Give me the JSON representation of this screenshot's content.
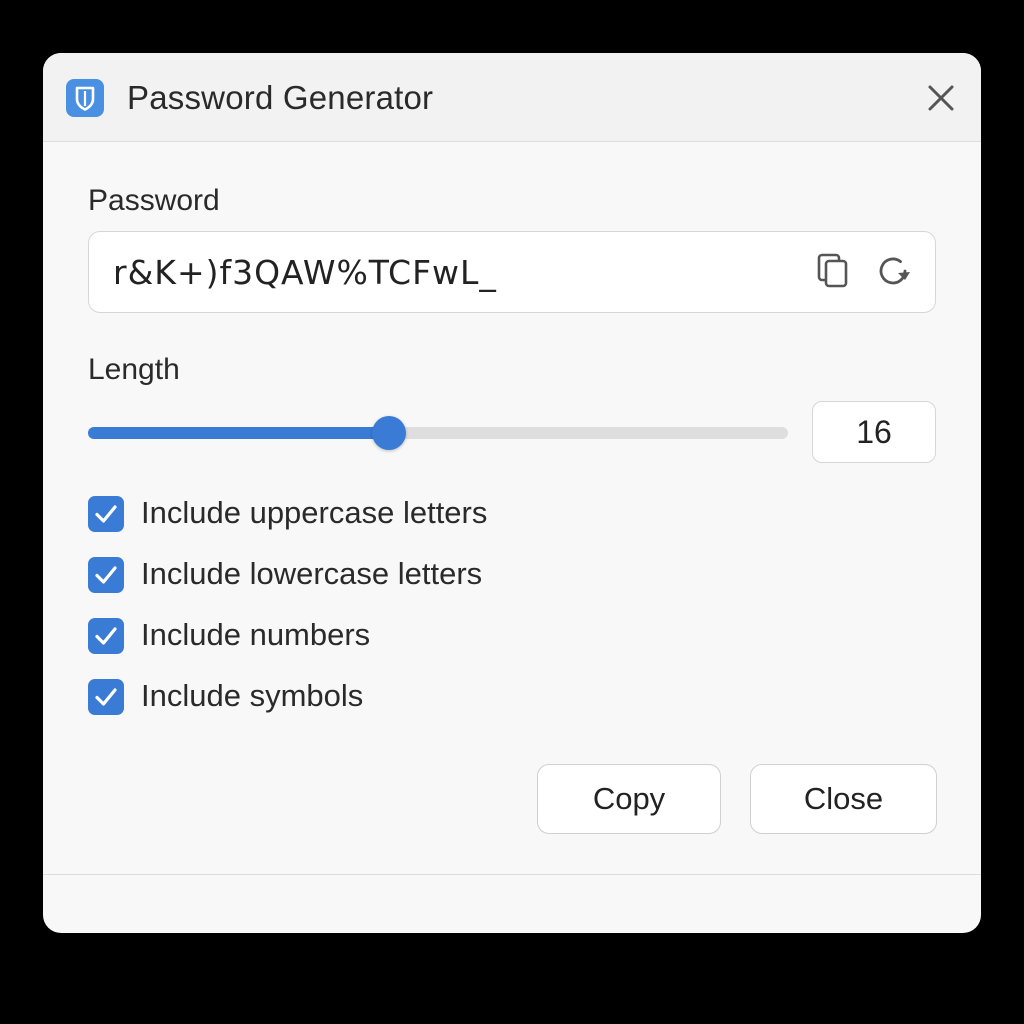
{
  "window": {
    "title": "Password Generator",
    "app_icon": "shield-icon",
    "close_icon": "close-icon"
  },
  "password": {
    "label": "Password",
    "value": "r&K+)f3QAW%TCFwL_",
    "copy_icon": "copy-icon",
    "regenerate_icon": "refresh-icon"
  },
  "length": {
    "label": "Length",
    "value": "16",
    "slider_fraction": 0.43
  },
  "options": [
    {
      "label": "Include uppercase letters",
      "checked": true
    },
    {
      "label": "Include lowercase letters",
      "checked": true
    },
    {
      "label": "Include numbers",
      "checked": true
    },
    {
      "label": "Include symbols",
      "checked": true
    }
  ],
  "buttons": {
    "copy_label": "Copy",
    "close_label": "Close"
  },
  "colors": {
    "accent": "#3a7bd5",
    "app_icon": "#4a90e2"
  }
}
